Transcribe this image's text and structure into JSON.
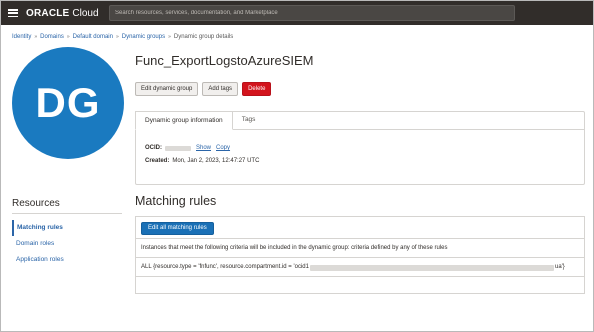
{
  "header": {
    "brand": "ORACLE",
    "product": "Cloud",
    "search_placeholder": "Search resources, services, documentation, and Marketplace"
  },
  "breadcrumb": {
    "items": [
      "Identity",
      "Domains",
      "Default domain",
      "Dynamic groups"
    ],
    "current": "Dynamic group details"
  },
  "avatar": {
    "initials": "DG",
    "color": "#1a7ac0"
  },
  "page": {
    "title": "Func_ExportLogstoAzureSIEM",
    "buttons": {
      "edit": "Edit dynamic group",
      "add_tags": "Add tags",
      "delete": "Delete"
    }
  },
  "tabs": [
    "Dynamic group information",
    "Tags"
  ],
  "info": {
    "ocid_label": "OCID:",
    "show_link": "Show",
    "copy_link": "Copy",
    "created_label": "Created:",
    "created_value": "Mon, Jan 2, 2023, 12:47:27 UTC"
  },
  "resources": {
    "title": "Resources",
    "items": [
      "Matching rules",
      "Domain roles",
      "Application roles"
    ],
    "active": "Matching rules"
  },
  "matching_rules": {
    "title": "Matching rules",
    "edit_button": "Edit all matching rules",
    "description": "Instances that meet the following criteria will be included in the dynamic group: criteria defined by any of these rules",
    "rule_prefix": "ALL {resource.type = 'fnfunc', resource.compartment.id = 'ocid1",
    "rule_suffix": "ua'}"
  },
  "colors": {
    "topbar": "#312d2a",
    "link": "#2b65a8",
    "danger": "#d3141d",
    "primary": "#1a70b6"
  }
}
